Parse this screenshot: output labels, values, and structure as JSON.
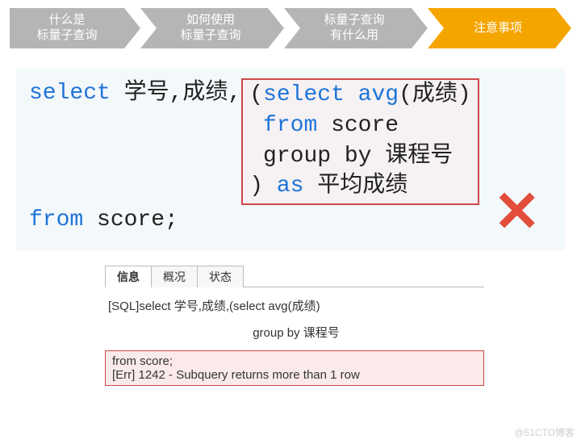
{
  "breadcrumb": {
    "items": [
      {
        "line1": "什么是",
        "line2": "标量子查询"
      },
      {
        "line1": "如何使用",
        "line2": "标量子查询"
      },
      {
        "line1": "标量子查询",
        "line2": "有什么用"
      },
      {
        "line1": "注意事项",
        "line2": ""
      }
    ]
  },
  "sql": {
    "kw_select1": "select",
    "cols": " 学号,成绩,",
    "paren_open": "(",
    "kw_select2": "select avg",
    "avg_arg": "(成绩)",
    "kw_from2": " from",
    "tbl2": " score",
    "group_by": " group by 课程号",
    "paren_close": ")",
    "kw_as": " as",
    "alias": " 平均成绩",
    "kw_from1": "from",
    "tbl1": " score;"
  },
  "tabs": {
    "t1": "信息",
    "t2": "概况",
    "t3": "状态"
  },
  "output": {
    "line1": "[SQL]select 学号,成绩,(select avg(成绩)",
    "line2": "group by 课程号",
    "err1": "from score;",
    "err2": "[Err] 1242 - Subquery returns more than 1 row"
  },
  "mark_x": "✕",
  "watermark": "@51CTO博客"
}
